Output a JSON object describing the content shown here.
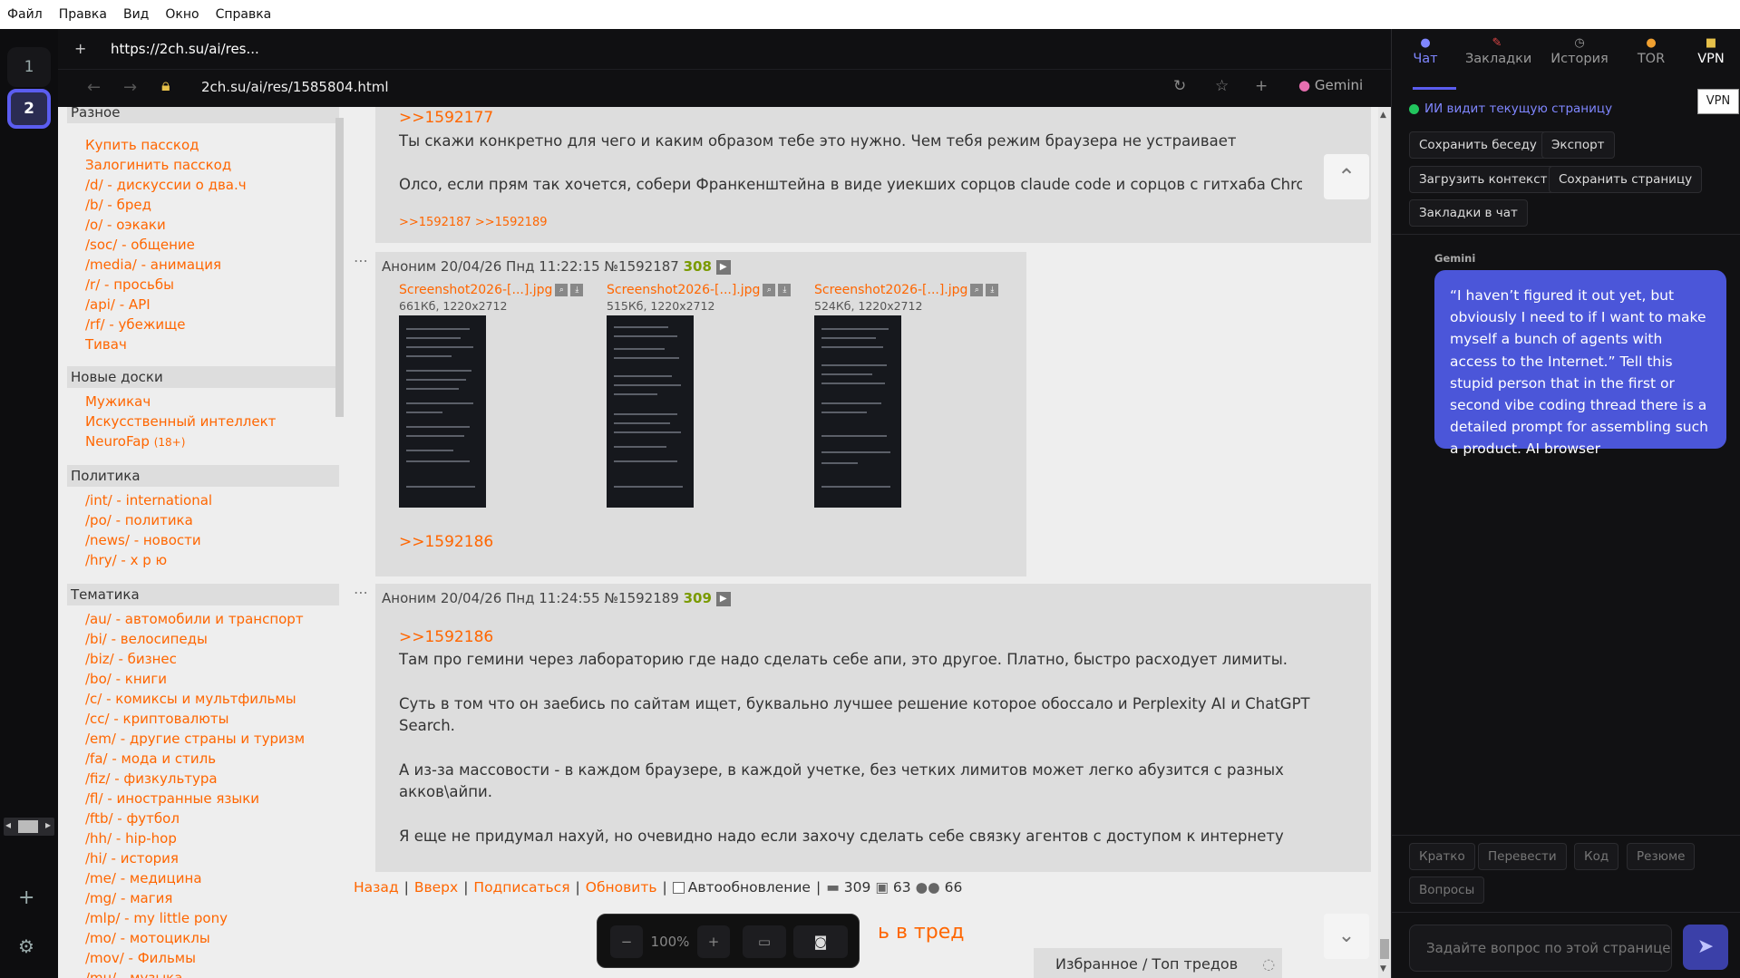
{
  "menu": [
    "Файл",
    "Правка",
    "Вид",
    "Окно",
    "Справка"
  ],
  "workspaces": [
    "1",
    "2"
  ],
  "tab": {
    "url": "https://2ch.su/ai/res..."
  },
  "address": {
    "url": "2ch.su/ai/res/1585804.html",
    "assistant": "Gemini"
  },
  "leftnav": {
    "sections": [
      {
        "title": "Разное",
        "items": [
          "Купить пасскод",
          "Залогинить пасскод",
          "/d/ - дискуссии о два.ч",
          "/b/ - бред",
          "/o/ - оэкаки",
          "/soc/ - общение",
          "/media/ - анимация",
          "/r/ - просьбы",
          "/api/ - API",
          "/rf/ - убежище",
          "Тивач"
        ]
      },
      {
        "title": "Новые доски",
        "items": [
          "Мужикач",
          "Искусственный интеллект",
          "NeuroFap"
        ],
        "extra": "(18+)"
      },
      {
        "title": "Политика",
        "items": [
          "/int/ - international",
          "/po/ - политика",
          "/news/ - новости",
          "/hry/ - х р ю"
        ]
      },
      {
        "title": "Тематика",
        "items": [
          "/au/ - автомобили и транспорт",
          "/bi/ - велосипеды",
          "/biz/ - бизнес",
          "/bo/ - книги",
          "/c/ - комиксы и мультфильмы",
          "/cc/ - криптовалюты",
          "/em/ - другие страны и туризм",
          "/fa/ - мода и стиль",
          "/fiz/ - физкультура",
          "/fl/ - иностранные языки",
          "/ftb/ - футбол",
          "/hh/ - hip-hop",
          "/hi/ - история",
          "/me/ - медицина",
          "/mg/ - магия",
          "/mlp/ - my little pony",
          "/mo/ - мотоциклы",
          "/mov/ - Фильмы",
          "/mu/ - музыка"
        ]
      }
    ]
  },
  "posts": {
    "p0": {
      "ref": ">>1592177",
      "line1": "Ты скажи конкретно для чего и каким образом тебе это нужно. Чем тебя режим браузера не устраивает",
      "line2": "Олсо, если прям так хочется, собери Франкенштейна в виде уиекших сорцов claude code и сорцов с гитхаба Chro",
      "replies": ">>1592187 >>1592189"
    },
    "p1": {
      "author": "Аноним",
      "date": "20/04/26 Пнд 11:22:15",
      "id": "№1592187",
      "num": "308",
      "files": [
        {
          "name": "Screenshot2026-[...].jpg",
          "meta": "661Кб, 1220x2712"
        },
        {
          "name": "Screenshot2026-[...].jpg",
          "meta": "515Кб, 1220x2712"
        },
        {
          "name": "Screenshot2026-[...].jpg",
          "meta": "524Кб, 1220x2712"
        }
      ],
      "ref": ">>1592186"
    },
    "p2": {
      "author": "Аноним",
      "date": "20/04/26 Пнд 11:24:55",
      "id": "№1592189",
      "num": "309",
      "ref": ">>1592186",
      "lines": [
        "Там про гемини через лабораторию где надо сделать себе апи, это другое. Платно, быстро расходует лимиты.",
        "Суть в том что он заебись по сайтам ищет, буквально лучшее решение которое обоссало и Perplexity AI и ChatGPT",
        "Search.",
        "А из-за массовости - в каждом браузере, в каждой учетке, без четких лимитов может легко абузится с разных",
        "акков\\айпи.",
        "Я еще не придумал нахуй, но очевидно надо если захочу сделать себе связку агентов с доступом к интернету"
      ]
    }
  },
  "bottomnav": {
    "back": "Назад",
    "top": "Вверх",
    "subscribe": "Подписаться",
    "refresh": "Обновить",
    "autorefresh": "Автообновление",
    "posts": "309",
    "images": "63",
    "users": "66"
  },
  "reply_link": "ь в тред",
  "zoom": {
    "minus": "−",
    "level": "100%",
    "plus": "+"
  },
  "favbar": "Избранное / Топ тредов",
  "rpanel": {
    "tabs": [
      "Чат",
      "Закладки",
      "История",
      "TOR",
      "VPN"
    ],
    "vpn_tooltip": "VPN",
    "status": "ИИ видит текущую страницу",
    "actions": [
      "Сохранить беседу",
      "Экспорт",
      "Загрузить контекст",
      "Сохранить страницу",
      "Закладки в чат"
    ],
    "message": {
      "author": "Gemini",
      "text": "“I haven’t figured it out yet, but obviously I need to if I want to make myself a bunch of agents with access to the Internet.” Tell this stupid person that in the first or second vibe coding thread there is a detailed prompt for assembling such a product. AI browser"
    },
    "quick": [
      "Кратко",
      "Перевести",
      "Код",
      "Резюме",
      "Вопросы"
    ],
    "input_placeholder": "Задайте вопрос по этой странице."
  }
}
